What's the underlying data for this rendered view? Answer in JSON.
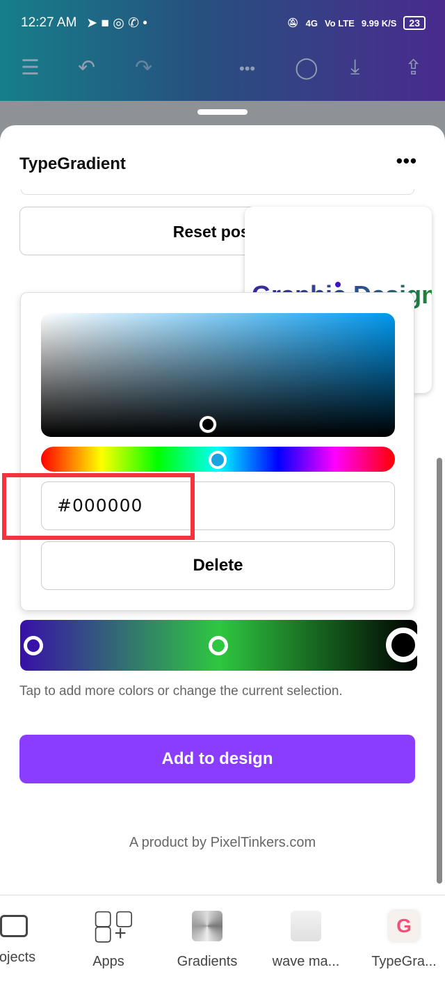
{
  "status": {
    "time": "12:27 AM",
    "net": "4G",
    "volte": "Vo LTE",
    "speed": "9.99 K/S",
    "battery": "23"
  },
  "toolbar": {
    "icons": [
      "menu-icon",
      "undo-icon",
      "redo-icon",
      "more-icon",
      "comment-icon",
      "download-icon",
      "share-icon"
    ]
  },
  "panel": {
    "title": "TypeGradient",
    "more": "•••",
    "reset_label": "Reset position",
    "preview_text": "Graphic Design"
  },
  "picker": {
    "hex_value": "#000000",
    "delete_label": "Delete",
    "hue_color": "#1aa3e0",
    "base_color": "#0098ef"
  },
  "gradient": {
    "stops": [
      "#3810a8",
      "#2ec740",
      "#000000"
    ],
    "selected_stop": 2
  },
  "hint": "Tap to add more colors or change the current selection.",
  "add_label": "Add to design",
  "footer": "A product by PixelTinkers.com",
  "nav": [
    {
      "label": "Projects",
      "icon": "folder-icon"
    },
    {
      "label": "Apps",
      "icon": "apps-icon"
    },
    {
      "label": "Gradients",
      "icon": "gradients-icon"
    },
    {
      "label": "wave ma...",
      "icon": "wave-icon"
    },
    {
      "label": "TypeGra...",
      "icon": "typegradient-icon"
    }
  ],
  "colors": {
    "accent": "#8b3dff",
    "highlight": "#f5333f"
  }
}
